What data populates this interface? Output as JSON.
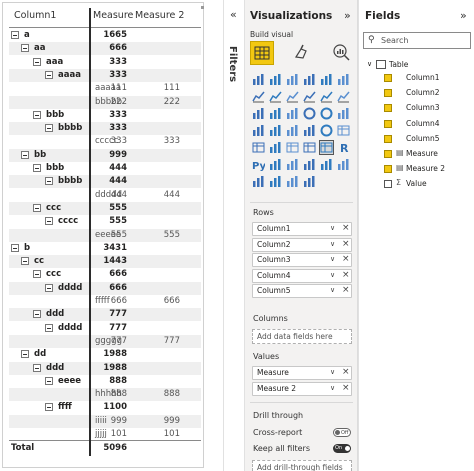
{
  "matrix": {
    "headers": {
      "col1": "Column1",
      "measure": "Measure",
      "measure2": "Measure 2"
    },
    "rows": [
      {
        "label": "a",
        "m1": "1665",
        "m2": "",
        "level": 0,
        "bold": true,
        "toggle": true,
        "shade": false
      },
      {
        "label": "aa",
        "m1": "666",
        "m2": "",
        "level": 1,
        "bold": true,
        "toggle": true,
        "shade": true
      },
      {
        "label": "aaa",
        "m1": "333",
        "m2": "",
        "level": 2,
        "bold": true,
        "toggle": true,
        "shade": false
      },
      {
        "label": "aaaa",
        "m1": "333",
        "m2": "",
        "level": 3,
        "bold": true,
        "toggle": true,
        "shade": true
      },
      {
        "label": "aaaaa",
        "m1": "111",
        "m2": "111",
        "level": 4,
        "bold": false,
        "toggle": false,
        "shade": false
      },
      {
        "label": "bbbbb",
        "m1": "222",
        "m2": "222",
        "level": 4,
        "bold": false,
        "toggle": false,
        "shade": true
      },
      {
        "label": "bbb",
        "m1": "333",
        "m2": "",
        "level": 2,
        "bold": true,
        "toggle": true,
        "shade": false
      },
      {
        "label": "bbbb",
        "m1": "333",
        "m2": "",
        "level": 3,
        "bold": true,
        "toggle": true,
        "shade": true
      },
      {
        "label": "ccccc",
        "m1": "333",
        "m2": "333",
        "level": 4,
        "bold": false,
        "toggle": false,
        "shade": false
      },
      {
        "label": "bb",
        "m1": "999",
        "m2": "",
        "level": 1,
        "bold": true,
        "toggle": true,
        "shade": true
      },
      {
        "label": "bbb",
        "m1": "444",
        "m2": "",
        "level": 2,
        "bold": true,
        "toggle": true,
        "shade": false
      },
      {
        "label": "bbbb",
        "m1": "444",
        "m2": "",
        "level": 3,
        "bold": true,
        "toggle": true,
        "shade": true
      },
      {
        "label": "ddddd",
        "m1": "444",
        "m2": "444",
        "level": 4,
        "bold": false,
        "toggle": false,
        "shade": false
      },
      {
        "label": "ccc",
        "m1": "555",
        "m2": "",
        "level": 2,
        "bold": true,
        "toggle": true,
        "shade": true
      },
      {
        "label": "cccc",
        "m1": "555",
        "m2": "",
        "level": 3,
        "bold": true,
        "toggle": true,
        "shade": false
      },
      {
        "label": "eeeee",
        "m1": "555",
        "m2": "555",
        "level": 4,
        "bold": false,
        "toggle": false,
        "shade": true
      },
      {
        "label": "b",
        "m1": "3431",
        "m2": "",
        "level": 0,
        "bold": true,
        "toggle": true,
        "shade": false
      },
      {
        "label": "cc",
        "m1": "1443",
        "m2": "",
        "level": 1,
        "bold": true,
        "toggle": true,
        "shade": true
      },
      {
        "label": "ccc",
        "m1": "666",
        "m2": "",
        "level": 2,
        "bold": true,
        "toggle": true,
        "shade": false
      },
      {
        "label": "dddd",
        "m1": "666",
        "m2": "",
        "level": 3,
        "bold": true,
        "toggle": true,
        "shade": true
      },
      {
        "label": "fffff",
        "m1": "666",
        "m2": "666",
        "level": 4,
        "bold": false,
        "toggle": false,
        "shade": false
      },
      {
        "label": "ddd",
        "m1": "777",
        "m2": "",
        "level": 2,
        "bold": true,
        "toggle": true,
        "shade": true
      },
      {
        "label": "dddd",
        "m1": "777",
        "m2": "",
        "level": 3,
        "bold": true,
        "toggle": true,
        "shade": false
      },
      {
        "label": "ggggg",
        "m1": "777",
        "m2": "777",
        "level": 4,
        "bold": false,
        "toggle": false,
        "shade": true
      },
      {
        "label": "dd",
        "m1": "1988",
        "m2": "",
        "level": 1,
        "bold": true,
        "toggle": true,
        "shade": false
      },
      {
        "label": "ddd",
        "m1": "1988",
        "m2": "",
        "level": 2,
        "bold": true,
        "toggle": true,
        "shade": true
      },
      {
        "label": "eeee",
        "m1": "888",
        "m2": "",
        "level": 3,
        "bold": true,
        "toggle": true,
        "shade": false
      },
      {
        "label": "hhhhh",
        "m1": "888",
        "m2": "888",
        "level": 4,
        "bold": false,
        "toggle": false,
        "shade": true
      },
      {
        "label": "ffff",
        "m1": "1100",
        "m2": "",
        "level": 3,
        "bold": true,
        "toggle": true,
        "shade": false
      },
      {
        "label": "iiiii",
        "m1": "999",
        "m2": "999",
        "level": 4,
        "bold": false,
        "toggle": false,
        "shade": true
      },
      {
        "label": "jjjjj",
        "m1": "101",
        "m2": "101",
        "level": 4,
        "bold": false,
        "toggle": false,
        "shade": false
      }
    ],
    "total": {
      "label": "Total",
      "m1": "5096",
      "m2": ""
    }
  },
  "filters": {
    "label": "Filters",
    "collapse_icon": "chevron-double-left-icon"
  },
  "visualizations": {
    "title": "Visualizations",
    "build_visual": "Build visual",
    "rows_label": "Rows",
    "rows": [
      "Column1",
      "Column2",
      "Column3",
      "Column4",
      "Column5"
    ],
    "columns_label": "Columns",
    "columns_placeholder": "Add data fields here",
    "values_label": "Values",
    "values": [
      "Measure",
      "Measure 2"
    ],
    "drill_label": "Drill through",
    "cross_report": "Cross-report",
    "cross_report_state": "Off",
    "keep_filters": "Keep all filters",
    "keep_filters_state": "On",
    "drill_placeholder": "Add drill-through fields here"
  },
  "fields": {
    "title": "Fields",
    "search_placeholder": "Search",
    "table_name": "Table",
    "items": [
      {
        "name": "Column1",
        "checked": true,
        "icon": ""
      },
      {
        "name": "Column2",
        "checked": true,
        "icon": ""
      },
      {
        "name": "Column3",
        "checked": true,
        "icon": ""
      },
      {
        "name": "Column4",
        "checked": true,
        "icon": ""
      },
      {
        "name": "Column5",
        "checked": true,
        "icon": ""
      },
      {
        "name": "Measure",
        "checked": true,
        "icon": "measure-icon"
      },
      {
        "name": "Measure 2",
        "checked": true,
        "icon": "measure-icon"
      },
      {
        "name": "Value",
        "checked": false,
        "icon": "sigma-icon"
      }
    ]
  },
  "colors": {
    "accent": "#f2c811",
    "pane_bg": "#f3f2f1"
  }
}
